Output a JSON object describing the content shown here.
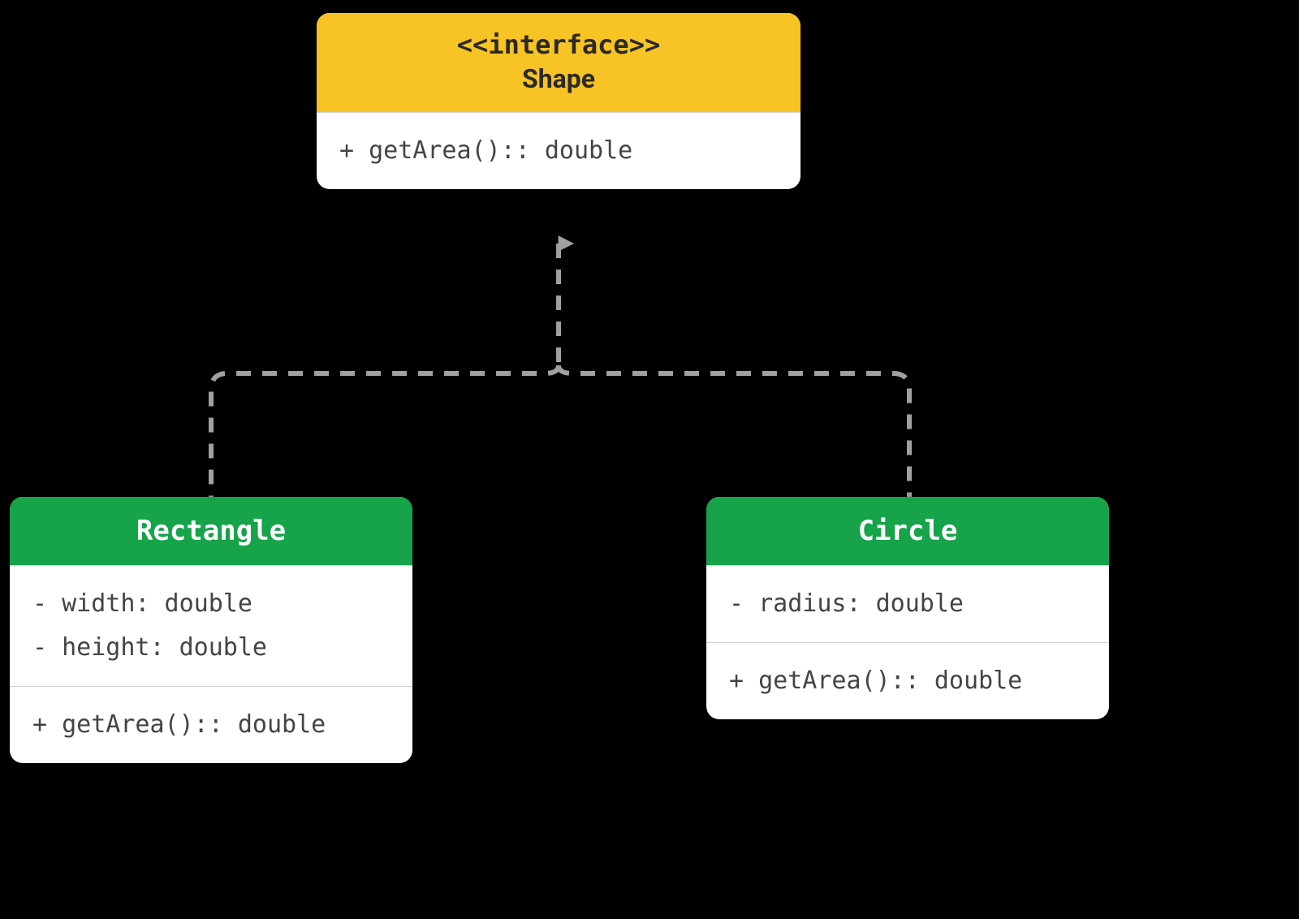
{
  "interface": {
    "stereotype": "<<interface>>",
    "name": "Shape",
    "methods": [
      "+ getArea():: double"
    ]
  },
  "rectangle": {
    "name": "Rectangle",
    "attributes": [
      "- width: double",
      "- height: double"
    ],
    "methods": [
      "+ getArea():: double"
    ]
  },
  "circle": {
    "name": "Circle",
    "attributes": [
      "- radius: double"
    ],
    "methods": [
      "+ getArea():: double"
    ]
  },
  "colors": {
    "interfaceHeader": "#f7c325",
    "classHeader": "#16a34a",
    "connector": "#a0a0a0"
  }
}
